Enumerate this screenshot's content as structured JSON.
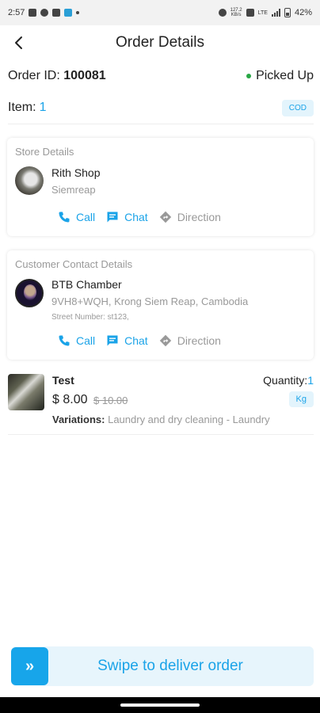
{
  "status_bar": {
    "time": "2:57",
    "net_speed_value": "127.2",
    "net_speed_unit": "KB/s",
    "network_type": "LTE",
    "battery": "42%"
  },
  "header": {
    "title": "Order Details"
  },
  "order": {
    "id_label": "Order ID:",
    "id_value": "100081",
    "status": "Picked Up",
    "status_color": "#28a745"
  },
  "items": {
    "label": "Item:",
    "count": "1",
    "payment_badge": "COD"
  },
  "store": {
    "section_title": "Store Details",
    "name": "Rith Shop",
    "location": "Siemreap",
    "actions": {
      "call": "Call",
      "chat": "Chat",
      "direction": "Direction"
    }
  },
  "customer": {
    "section_title": "Customer Contact Details",
    "name": "BTB Chamber",
    "address": "9VH8+WQH, Krong Siem Reap, Cambodia",
    "street": "Street Number: st123,",
    "actions": {
      "call": "Call",
      "chat": "Chat",
      "direction": "Direction"
    }
  },
  "product": {
    "name": "Test",
    "quantity_label": "Quantity:",
    "quantity_value": "1",
    "price": "$ 8.00",
    "original_price": "$ 10.00",
    "unit": "Kg",
    "variations_label": "Variations:",
    "variations_value": "Laundry and dry cleaning - Laundry"
  },
  "swipe": {
    "label": "Swipe to deliver order",
    "handle_icon": "»"
  },
  "colors": {
    "accent": "#1aa3e8",
    "accent_bg": "#e3f4fc",
    "muted": "#999999"
  },
  "icons": [
    "back-arrow-icon",
    "phone-icon",
    "chat-icon",
    "direction-icon",
    "double-chevron-right-icon"
  ]
}
